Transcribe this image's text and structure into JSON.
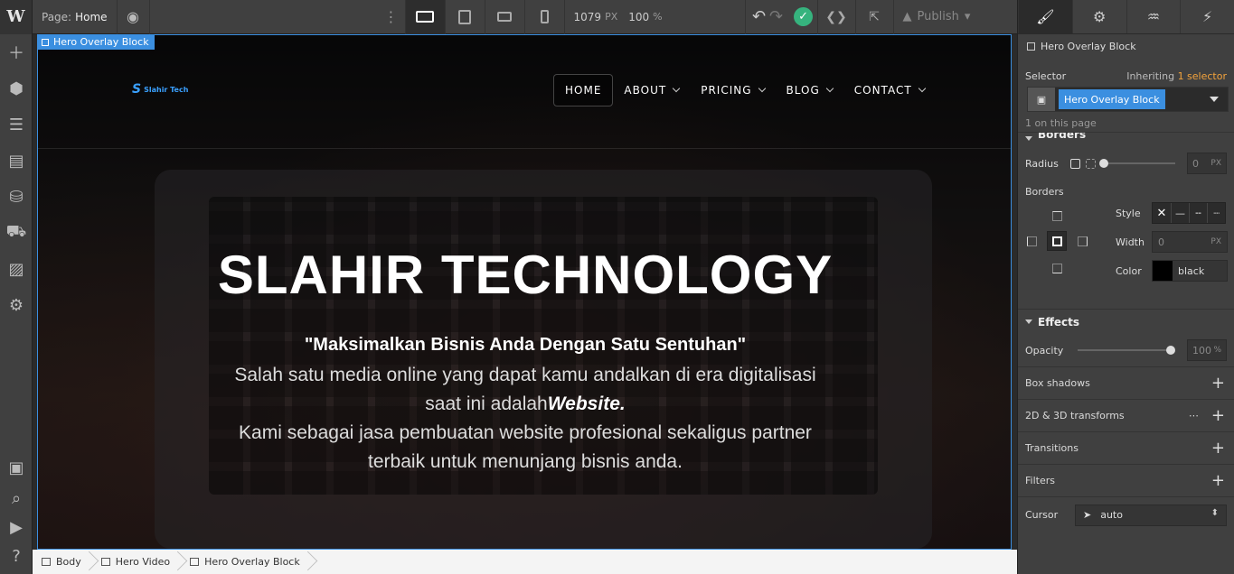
{
  "topbar": {
    "logo": "W",
    "page_label": "Page:",
    "page_value": "Home",
    "canvas_width": "1079",
    "canvas_width_unit": "PX",
    "zoom": "100",
    "zoom_unit": "%",
    "publish_label": "Publish"
  },
  "canvas": {
    "selected_label": "Hero Overlay Block",
    "brand": "Slahir Tech",
    "nav": [
      {
        "label": "HOME"
      },
      {
        "label": "ABOUT"
      },
      {
        "label": "PRICING"
      },
      {
        "label": "BLOG"
      },
      {
        "label": "CONTACT"
      }
    ],
    "hero_title": "SLAHIR TECHNOLOGY",
    "hero_tagline": "\"Maksimalkan Bisnis Anda Dengan Satu Sentuhan\"",
    "hero_line1": "Salah satu media online yang dapat kamu andalkan di era digitalisasi saat ini adalah",
    "hero_line1_em": "Website.",
    "hero_line2": "Kami sebagai jasa pembuatan website profesional sekaligus partner terbaik untuk menunjang bisnis anda."
  },
  "breadcrumb": [
    "Body",
    "Hero Video",
    "Hero Overlay Block"
  ],
  "panel": {
    "element_name": "Hero Overlay Block",
    "selector_label": "Selector",
    "inheriting_label": "Inheriting",
    "inheriting_count": "1 selector",
    "selector_tag": "Hero Overlay Block",
    "on_page": "1 on this page",
    "borders_section": "Borders",
    "radius_label": "Radius",
    "radius_value": "0",
    "radius_unit": "PX",
    "borders_label": "Borders",
    "style_label": "Style",
    "width_label": "Width",
    "width_value": "0",
    "width_unit": "PX",
    "color_label": "Color",
    "color_value": "black",
    "effects_section": "Effects",
    "opacity_label": "Opacity",
    "opacity_value": "100",
    "opacity_unit": "%",
    "box_shadows": "Box shadows",
    "transforms": "2D & 3D transforms",
    "transitions": "Transitions",
    "filters": "Filters",
    "cursor_label": "Cursor",
    "cursor_value": "auto"
  },
  "colors": {
    "accent": "#3b8fe0",
    "success": "#36b37e",
    "inherit_highlight": "#f3a33c"
  }
}
